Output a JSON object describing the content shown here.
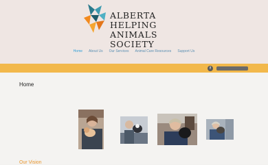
{
  "site": {
    "name_line1": "Alberta Helping",
    "name_line2": "Animals Society",
    "logo_icon": "origami-bird-logo"
  },
  "nav": {
    "items": [
      {
        "label": "Home",
        "active": true
      },
      {
        "label": "About Us",
        "active": false
      },
      {
        "label": "Our Services",
        "active": false
      },
      {
        "label": "Animal Care Resources",
        "active": false
      },
      {
        "label": "Support Us",
        "active": false
      }
    ]
  },
  "topbar": {
    "social_icon": "facebook-icon",
    "social_glyph": "f",
    "search_placeholder": ""
  },
  "main": {
    "page_title": "Home",
    "section_title": "Our Vision",
    "photos": [
      {
        "name": "photo-woman-with-cat"
      },
      {
        "name": "photo-person-with-dog"
      },
      {
        "name": "photo-woman-hugging-dog"
      },
      {
        "name": "photo-woman-with-small-dog"
      }
    ]
  },
  "colors": {
    "header_bg": "#efe6e3",
    "accent_bar": "#f2b84b",
    "nav_link": "#5a8fb2",
    "nav_active": "#2e9fd8",
    "section_heading": "#e8962e"
  }
}
